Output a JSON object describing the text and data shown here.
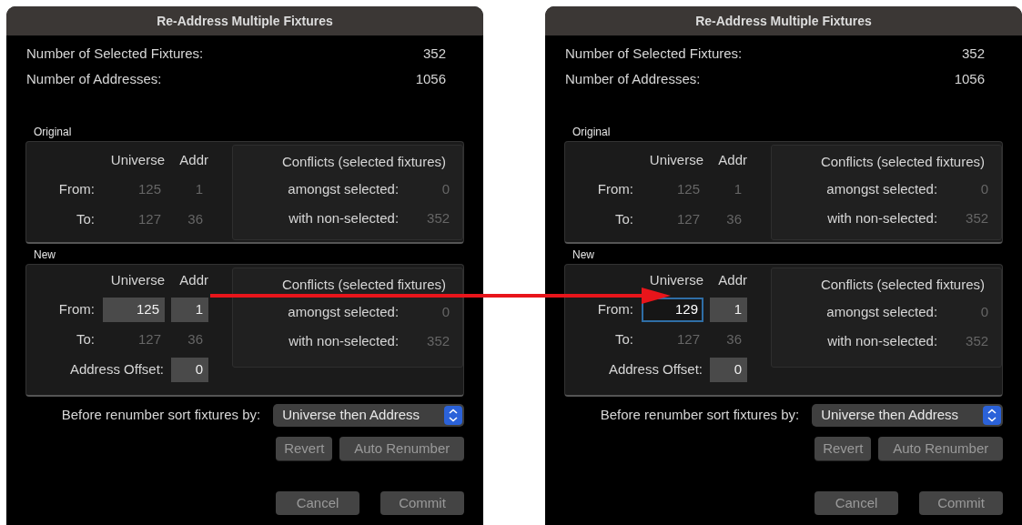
{
  "dialogs": [
    {
      "title": "Re-Address Multiple Fixtures",
      "stats": [
        {
          "label": "Number of Selected Fixtures:",
          "value": "352"
        },
        {
          "label": "Number of Addresses:",
          "value": "1056"
        }
      ],
      "original": {
        "title": "Original",
        "columns": [
          "Universe",
          "Addr"
        ],
        "rows": [
          {
            "label": "From:",
            "universe": "125",
            "addr": "1"
          },
          {
            "label": "To:",
            "universe": "127",
            "addr": "36"
          }
        ],
        "conflicts": {
          "title": "Conflicts (selected fixtures)",
          "rows": [
            {
              "label": "amongst selected:",
              "value": "0"
            },
            {
              "label": "with non-selected:",
              "value": "352"
            }
          ]
        }
      },
      "new": {
        "title": "New",
        "columns": [
          "Universe",
          "Addr"
        ],
        "rows": [
          {
            "kind": "input",
            "label": "From:",
            "universe": {
              "value": "125",
              "focused": false
            },
            "addr": {
              "value": "1",
              "focused": false
            }
          },
          {
            "kind": "readout",
            "label": "To:",
            "universe": "127",
            "addr": "36"
          },
          {
            "kind": "offset",
            "label": "Address Offset:",
            "value": "0",
            "focused": false
          }
        ],
        "conflicts": {
          "title": "Conflicts (selected fixtures)",
          "rows": [
            {
              "label": "amongst selected:",
              "value": "0"
            },
            {
              "label": "with non-selected:",
              "value": "352"
            }
          ]
        }
      },
      "sort": {
        "label": "Before renumber sort fixtures by:",
        "value": "Universe then Address"
      },
      "action_buttons": [
        "Revert",
        "Auto Renumber"
      ],
      "footer_buttons": [
        "Cancel",
        "Commit"
      ]
    },
    {
      "title": "Re-Address Multiple Fixtures",
      "stats": [
        {
          "label": "Number of Selected Fixtures:",
          "value": "352"
        },
        {
          "label": "Number of Addresses:",
          "value": "1056"
        }
      ],
      "original": {
        "title": "Original",
        "columns": [
          "Universe",
          "Addr"
        ],
        "rows": [
          {
            "label": "From:",
            "universe": "125",
            "addr": "1"
          },
          {
            "label": "To:",
            "universe": "127",
            "addr": "36"
          }
        ],
        "conflicts": {
          "title": "Conflicts (selected fixtures)",
          "rows": [
            {
              "label": "amongst selected:",
              "value": "0"
            },
            {
              "label": "with non-selected:",
              "value": "352"
            }
          ]
        }
      },
      "new": {
        "title": "New",
        "columns": [
          "Universe",
          "Addr"
        ],
        "rows": [
          {
            "kind": "input",
            "label": "From:",
            "universe": {
              "value": "129",
              "focused": true
            },
            "addr": {
              "value": "1",
              "focused": false
            }
          },
          {
            "kind": "readout",
            "label": "To:",
            "universe": "127",
            "addr": "36"
          },
          {
            "kind": "offset",
            "label": "Address Offset:",
            "value": "0",
            "focused": false
          }
        ],
        "conflicts": {
          "title": "Conflicts (selected fixtures)",
          "rows": [
            {
              "label": "amongst selected:",
              "value": "0"
            },
            {
              "label": "with non-selected:",
              "value": "352"
            }
          ]
        }
      },
      "sort": {
        "label": "Before renumber sort fixtures by:",
        "value": "Universe then Address"
      },
      "action_buttons": [
        "Revert",
        "Auto Renumber"
      ],
      "footer_buttons": [
        "Cancel",
        "Commit"
      ]
    }
  ]
}
